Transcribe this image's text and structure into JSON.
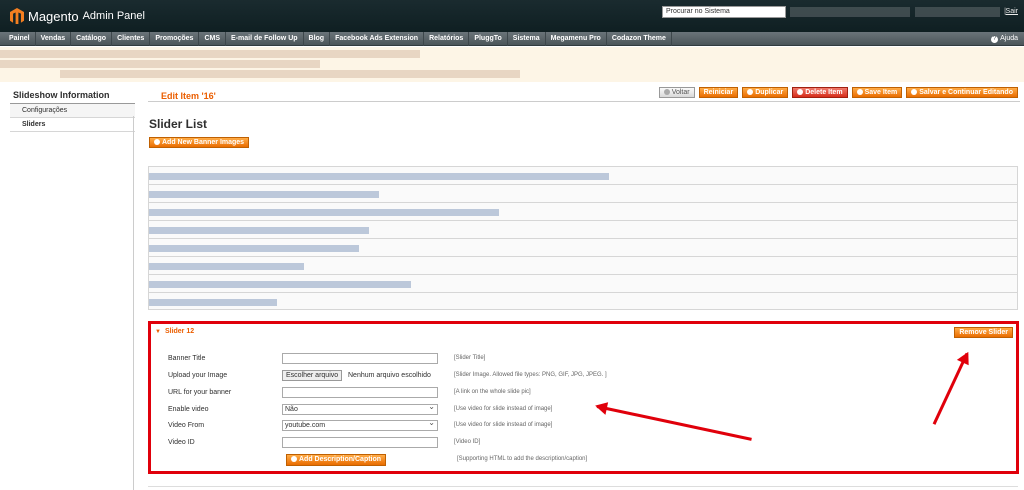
{
  "header": {
    "logo_brand": "Magento",
    "logo_sub": "Admin Panel",
    "search_placeholder": "Procurar no Sistema",
    "logout": "Sair",
    "separator": "|"
  },
  "nav": {
    "items": [
      "Painel",
      "Vendas",
      "Catálogo",
      "Clientes",
      "Promoções",
      "CMS",
      "E-mail de Follow Up",
      "Blog",
      "Facebook Ads Extension",
      "Relatórios",
      "PluggTo",
      "Sistema",
      "Megamenu Pro",
      "Codazon Theme"
    ],
    "help": "Ajuda"
  },
  "sidebar": {
    "title": "Slideshow Information",
    "tabs": [
      "Configurações",
      "Sliders"
    ]
  },
  "page": {
    "edit_title": "Edit Item '16'",
    "buttons": {
      "back": "Voltar",
      "reset": "Reiniciar",
      "duplicate": "Duplicar",
      "delete": "Delete Item",
      "save": "Save Item",
      "save_continue": "Salvar e Continuar Editando"
    },
    "slider_list_title": "Slider List",
    "add_banner": "Add New Banner Images"
  },
  "slider": {
    "title": "Slider 12",
    "remove": "Remove Slider",
    "fields": [
      {
        "label": "Banner Title",
        "value": "",
        "hint": "[Slider Title]"
      },
      {
        "label": "Upload your Image",
        "file_button": "Escolher arquivo",
        "file_status": "Nenhum arquivo escolhido",
        "hint": "[Slider Image. Allowed file types: PNG, GIF, JPG, JPEG. ]"
      },
      {
        "label": "URL for your banner",
        "value": "",
        "hint": "[A link on the whole slide pic]"
      },
      {
        "label": "Enable video",
        "value": "Não",
        "hint": "[Use video for slide instead of image]"
      },
      {
        "label": "Video From",
        "value": "youtube.com",
        "hint": "[Use video for slide instead of image]"
      },
      {
        "label": "Video ID",
        "value": "",
        "hint": "[Video ID]"
      }
    ],
    "add_caption": "Add Description/Caption",
    "caption_hint": "[Supporting HTML to add the description/caption]"
  },
  "colors": {
    "accent_orange": "#eb5e00",
    "annotation_red": "#e0000b",
    "header_bg": "#1a2b2f",
    "nav_bg": "#5b656a"
  }
}
